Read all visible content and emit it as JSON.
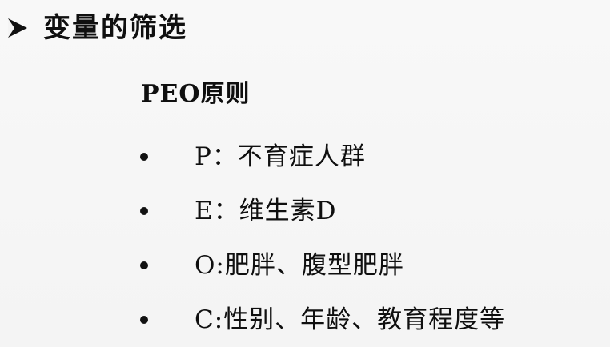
{
  "slide": {
    "title": "变量的筛选",
    "subtitle": "PEO原则",
    "bullets": [
      {
        "text": "P：不育症人群"
      },
      {
        "text": "E：维生素D"
      },
      {
        "text": "O:肥胖、腹型肥胖"
      },
      {
        "text": "C:性别、年龄、教育程度等"
      }
    ]
  },
  "icons": {
    "title_marker": "arrow-right-triangle-icon",
    "bullet_marker": "bullet-dot-icon"
  }
}
